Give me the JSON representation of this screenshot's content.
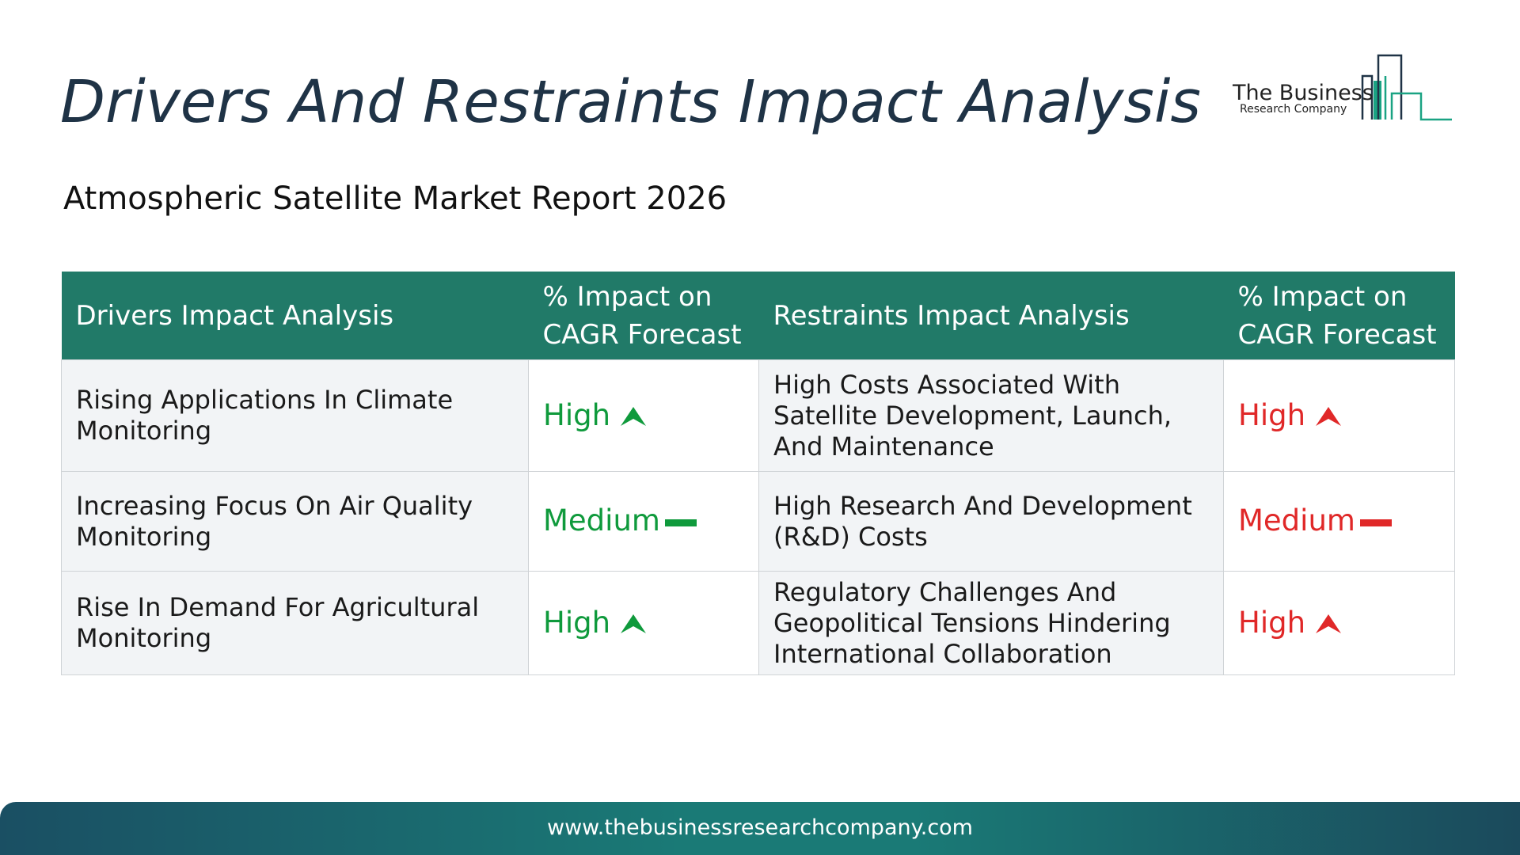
{
  "header": {
    "title": "Drivers And Restraints Impact Analysis",
    "subtitle": "Atmospheric Satellite Market Report 2026"
  },
  "logo": {
    "name_line1": "The Business",
    "name_line2": "Research Company",
    "colors": {
      "accent": "#1aa383",
      "dark": "#1f3346"
    }
  },
  "table": {
    "headers": [
      "Drivers Impact Analysis",
      "% Impact on CAGR Forecast",
      "Restraints Impact Analysis",
      "% Impact on CAGR Forecast"
    ],
    "rows": [
      {
        "driver": "Rising Applications In Climate Monitoring",
        "driver_impact": "High",
        "driver_icon": "arrow-up-icon",
        "restraint": "High Costs Associated With Satellite Development, Launch, And Maintenance",
        "restraint_impact": "High",
        "restraint_icon": "arrow-up-icon"
      },
      {
        "driver": "Increasing Focus On Air Quality Monitoring",
        "driver_impact": "Medium",
        "driver_icon": "dash-icon",
        "restraint": "High Research And Development (R&D) Costs",
        "restraint_impact": "Medium",
        "restraint_icon": "dash-icon"
      },
      {
        "driver": "Rise In Demand For Agricultural Monitoring",
        "driver_impact": "High",
        "driver_icon": "arrow-up-icon",
        "restraint": "Regulatory Challenges And Geopolitical Tensions Hindering International Collaboration",
        "restraint_impact": "High",
        "restraint_icon": "arrow-up-icon"
      }
    ],
    "colors": {
      "header_bg": "#217a68",
      "driver_impact": "#0f9a3c",
      "restraint_impact": "#e02828"
    }
  },
  "footer": {
    "url": "www.thebusinessresearchcompany.com"
  }
}
